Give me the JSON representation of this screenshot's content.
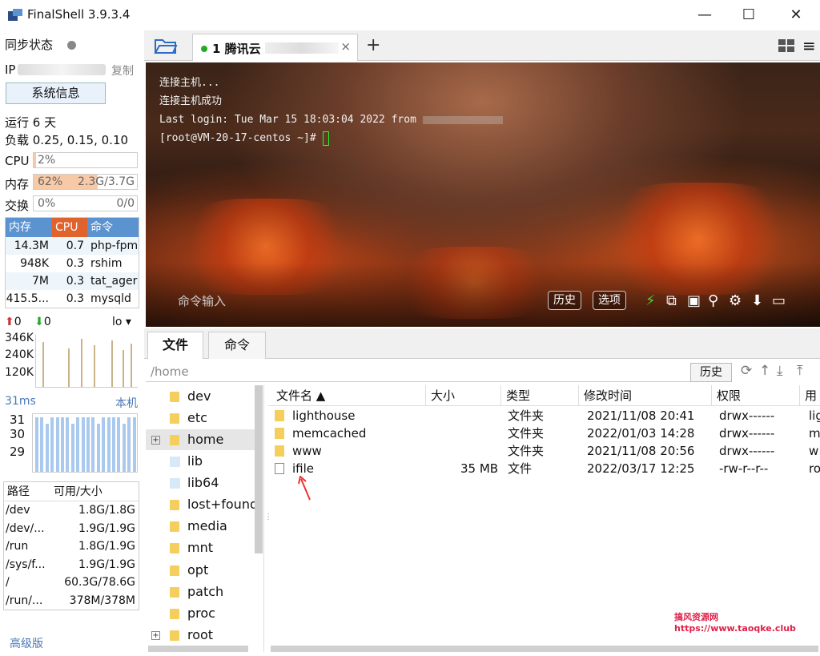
{
  "window": {
    "title": "FinalShell 3.9.3.4",
    "controls": {
      "minimize": "—",
      "maximize": "☐",
      "close": "✕"
    }
  },
  "left_panel": {
    "sync_label": "同步状态",
    "ip_prefix": "IP",
    "copy_label": "复制",
    "sysinfo_button": "系统信息",
    "uptime": "运行 6 天",
    "load": "负载 0.25, 0.15, 0.10",
    "cpu": {
      "label": "CPU",
      "value": "2%",
      "percent": 2
    },
    "mem": {
      "label": "内存",
      "value": "62%",
      "detail": "2.3G/3.7G",
      "percent": 62
    },
    "swap": {
      "label": "交换",
      "value": "0%",
      "detail": "0/0",
      "percent": 0
    },
    "proc_headers": [
      "内存",
      "CPU",
      "命令"
    ],
    "processes": [
      {
        "mem": "14.3M",
        "cpu": "0.7",
        "cmd": "php-fpm"
      },
      {
        "mem": "948K",
        "cpu": "0.3",
        "cmd": "rshim"
      },
      {
        "mem": "7M",
        "cpu": "0.3",
        "cmd": "tat_ager"
      },
      {
        "mem": "415.5...",
        "cpu": "0.3",
        "cmd": "mysqld"
      }
    ],
    "net": {
      "up": "0",
      "down": "0",
      "iface": "lo",
      "levels": [
        "346K",
        "240K",
        "120K"
      ]
    },
    "ping": {
      "latency": "31ms",
      "host": "本机",
      "levels": [
        "31",
        "30",
        "29"
      ]
    },
    "disk_headers": [
      "路径",
      "可用/大小"
    ],
    "disks": [
      {
        "path": "/dev",
        "size": "1.8G/1.8G"
      },
      {
        "path": "/dev/...",
        "size": "1.9G/1.9G"
      },
      {
        "path": "/run",
        "size": "1.8G/1.9G"
      },
      {
        "path": "/sys/f...",
        "size": "1.9G/1.9G"
      },
      {
        "path": "/",
        "size": "60.3G/78.6G"
      },
      {
        "path": "/run/...",
        "size": "378M/378M"
      }
    ],
    "advanced": "高级版"
  },
  "tabs": {
    "active_label": "1 腾讯云",
    "close": "×",
    "add": "+"
  },
  "terminal": {
    "lines": [
      "连接主机...",
      "连接主机成功",
      "Last login: Tue Mar 15 18:03:04 2022 from",
      "[root@VM-20-17-centos ~]#"
    ],
    "command_placeholder": "命令输入",
    "history_btn": "历史",
    "options_btn": "选项"
  },
  "lower": {
    "tab_files": "文件",
    "tab_commands": "命令",
    "path": "/home",
    "history_btn": "历史"
  },
  "tree": [
    {
      "name": "dev",
      "type": "folder"
    },
    {
      "name": "etc",
      "type": "folder"
    },
    {
      "name": "home",
      "type": "folder",
      "selected": true,
      "expander": "+"
    },
    {
      "name": "lib",
      "type": "link"
    },
    {
      "name": "lib64",
      "type": "link"
    },
    {
      "name": "lost+found",
      "type": "folder"
    },
    {
      "name": "media",
      "type": "folder"
    },
    {
      "name": "mnt",
      "type": "folder"
    },
    {
      "name": "opt",
      "type": "folder"
    },
    {
      "name": "patch",
      "type": "folder"
    },
    {
      "name": "proc",
      "type": "folder"
    },
    {
      "name": "root",
      "type": "folder",
      "expander": "+"
    }
  ],
  "file_headers": {
    "name": "文件名 ▲",
    "size": "大小",
    "type": "类型",
    "mtime": "修改时间",
    "perm": "权限",
    "owner": "用"
  },
  "files": [
    {
      "name": "lighthouse",
      "size": "",
      "type": "文件夹",
      "mtime": "2021/11/08 20:41",
      "perm": "drwx------",
      "owner": "lig",
      "is_dir": true
    },
    {
      "name": "memcached",
      "size": "",
      "type": "文件夹",
      "mtime": "2022/01/03 14:28",
      "perm": "drwx------",
      "owner": "m",
      "is_dir": true
    },
    {
      "name": "www",
      "size": "",
      "type": "文件夹",
      "mtime": "2021/11/08 20:56",
      "perm": "drwx------",
      "owner": "w",
      "is_dir": true
    },
    {
      "name": "ifile",
      "size": "35 MB",
      "type": "文件",
      "mtime": "2022/03/17 12:25",
      "perm": "-rw-r--r--",
      "owner": "ro",
      "is_dir": false
    }
  ],
  "watermark": {
    "line1": "搞风资源网",
    "line2": "https://www.taoqke.club"
  },
  "colors": {
    "accent": "#4a78b8",
    "proc_mem_head": "#5b93d1",
    "proc_cpu_head": "#e0622c",
    "proc_cmd_head": "#5b93d1",
    "meter_fill": "#f8c9a6",
    "folder": "#f5cf5e",
    "arrow": "#e33"
  }
}
